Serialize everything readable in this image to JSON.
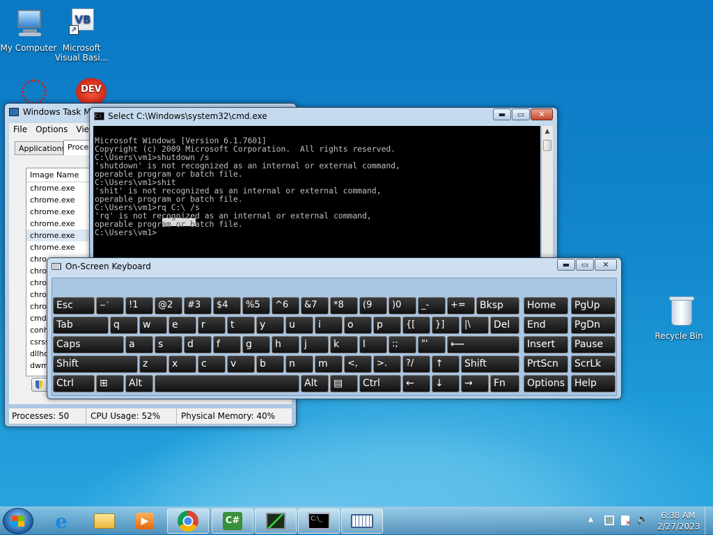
{
  "desktop": {
    "icons": [
      {
        "label": "My Computer"
      },
      {
        "label": "Microsoft Visual Basi..."
      },
      {
        "label": "Recycle Bin"
      }
    ]
  },
  "task_manager": {
    "title": "Windows Task M",
    "menu": [
      "File",
      "Options",
      "Vie"
    ],
    "tabs": [
      "Applications",
      "Proces"
    ],
    "column": "Image Name",
    "rows": [
      "chrome.exe",
      "chrome.exe",
      "chrome.exe",
      "chrome.exe",
      "chrome.exe",
      "chrome.exe",
      "chro",
      "chro",
      "chro",
      "chro",
      "chro",
      "cmd.",
      "conh",
      "csrss",
      "dllho",
      "dwm"
    ],
    "status": {
      "processes": "Processes: 50",
      "cpu": "CPU Usage: 52%",
      "memory": "Physical Memory: 40%"
    }
  },
  "cmd": {
    "title": "Select C:\\Windows\\system32\\cmd.exe",
    "lines": [
      "Microsoft Windows [Version 6.1.7601]",
      "Copyright (c) 2009 Microsoft Corporation.  All rights reserved.",
      "",
      "C:\\Users\\vm1>shutdown /s",
      "'shutdown' is not recognized as an internal or external command,",
      "operable program or batch file.",
      "",
      "C:\\Users\\vm1>shit",
      "'shit' is not recognized as an internal or external command,",
      "operable program or batch file.",
      "",
      "C:\\Users\\vm1>rq C:\\ /s",
      "'rq' is not recognized as an internal or external command,",
      "operable program or batch file.",
      "",
      "C:\\Users\\vm1>"
    ]
  },
  "osk": {
    "title": "On-Screen Keyboard",
    "rows": [
      [
        "Esc",
        "~`",
        "!1",
        "@2",
        "#3",
        "$4",
        "%5",
        "^6",
        "&7",
        "*8",
        "(9",
        ")0",
        "_-",
        "+=",
        "Bksp",
        "Home",
        "PgUp"
      ],
      [
        "Tab",
        "q",
        "w",
        "e",
        "r",
        "t",
        "y",
        "u",
        "i",
        "o",
        "p",
        "{[",
        "}]",
        "|\\",
        "Del",
        "End",
        "PgDn"
      ],
      [
        "Caps",
        "a",
        "s",
        "d",
        "f",
        "g",
        "h",
        "j",
        "k",
        "l",
        ":;",
        "\"'",
        "⟵",
        "Insert",
        "Pause"
      ],
      [
        "Shift",
        "z",
        "x",
        "c",
        "v",
        "b",
        "n",
        "m",
        "<,",
        ">.",
        "?/",
        "↑",
        "Shift",
        "PrtScn",
        "ScrLk"
      ],
      [
        "Ctrl",
        "⊞",
        "Alt",
        "",
        "Alt",
        "▤",
        "Ctrl",
        "←",
        "↓",
        "→",
        "Fn",
        "Options",
        "Help"
      ]
    ]
  },
  "taskbar": {
    "clock_time": "6:38 AM",
    "clock_date": "2/27/2023",
    "tray_chevron": "▲"
  }
}
